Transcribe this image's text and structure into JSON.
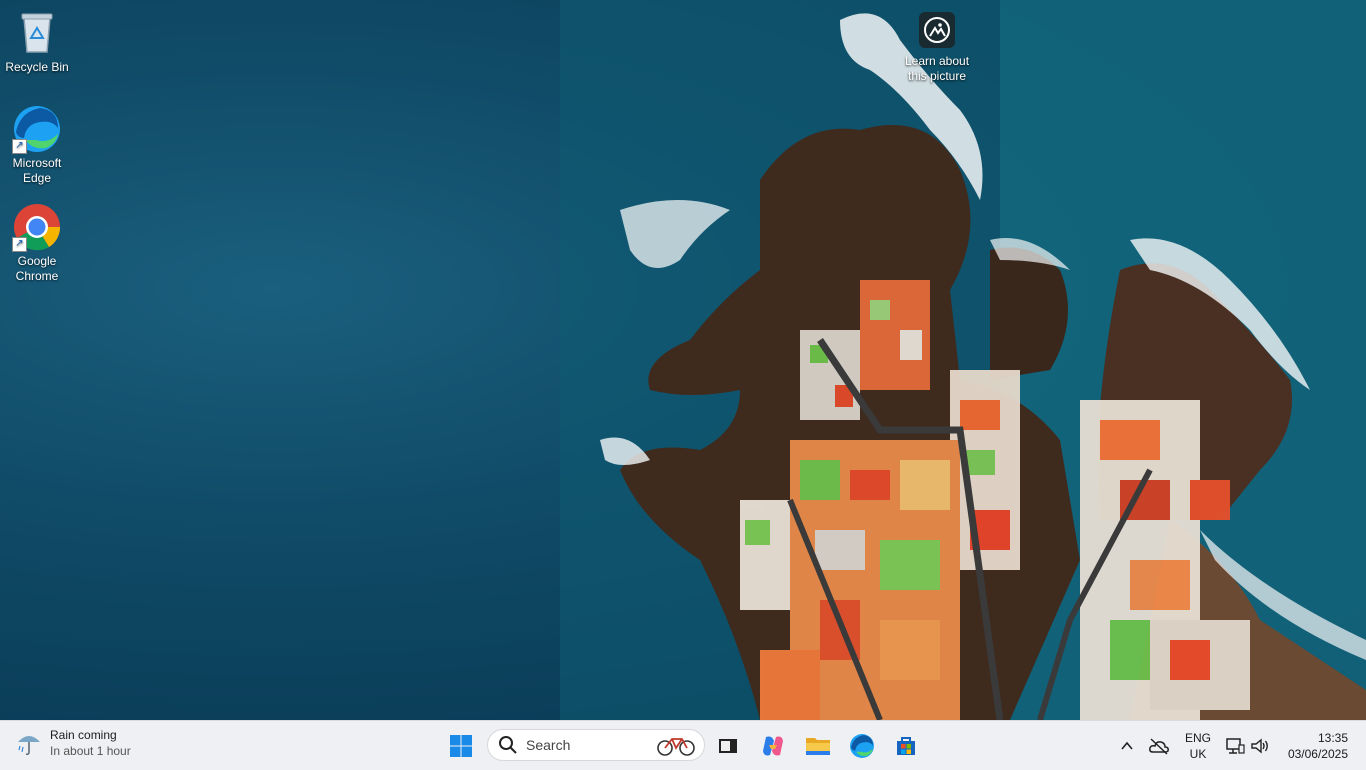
{
  "desktop": {
    "icons": [
      {
        "label": "Recycle Bin",
        "icon": "recycle-bin-icon"
      },
      {
        "label": "Microsoft Edge",
        "icon": "edge-icon"
      },
      {
        "label": "Google Chrome",
        "icon": "chrome-icon"
      }
    ],
    "learn_about": "Learn about this picture"
  },
  "taskbar": {
    "weather": {
      "title": "Rain coming",
      "subtitle": "In about 1 hour",
      "icon": "rain-umbrella-icon"
    },
    "search_placeholder": "Search",
    "pinned": [
      "start-icon",
      "task-view-icon",
      "copilot-icon",
      "file-explorer-icon",
      "edge-icon",
      "microsoft-store-icon"
    ],
    "tray": {
      "language_line1": "ENG",
      "language_line2": "UK",
      "time": "13:35",
      "date": "03/06/2025"
    }
  }
}
